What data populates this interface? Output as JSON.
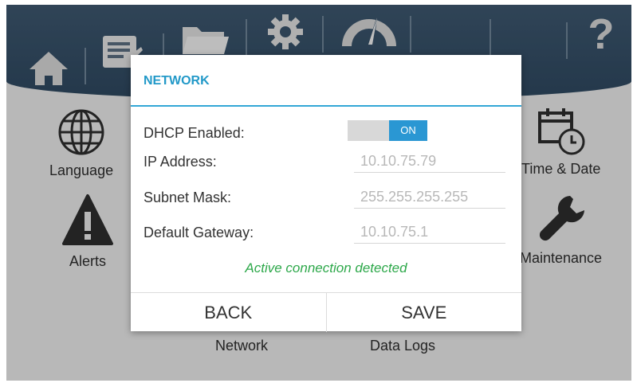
{
  "toolbar": {
    "icons": [
      "home-icon",
      "list-icon",
      "folder-icon",
      "gear-icon",
      "gauge-icon",
      "help-icon"
    ],
    "help_label": "?"
  },
  "background_menu": {
    "language": "Language",
    "time_date": "Time & Date",
    "alerts": "Alerts",
    "maintenance": "Maintenance",
    "network": "Network",
    "data_logs": "Data Logs"
  },
  "dialog": {
    "title": "NETWORK",
    "dhcp_label": "DHCP Enabled:",
    "dhcp_state": "ON",
    "ip_label": "IP Address:",
    "ip_value": "10.10.75.79",
    "subnet_label": "Subnet Mask:",
    "subnet_value": "255.255.255.255",
    "gateway_label": "Default Gateway:",
    "gateway_value": "10.10.75.1",
    "status": "Active connection detected",
    "back_label": "BACK",
    "save_label": "SAVE"
  },
  "colors": {
    "accent": "#2a97d3",
    "title": "#2299c8",
    "status": "#2da84a",
    "topbar": "#344f68"
  }
}
